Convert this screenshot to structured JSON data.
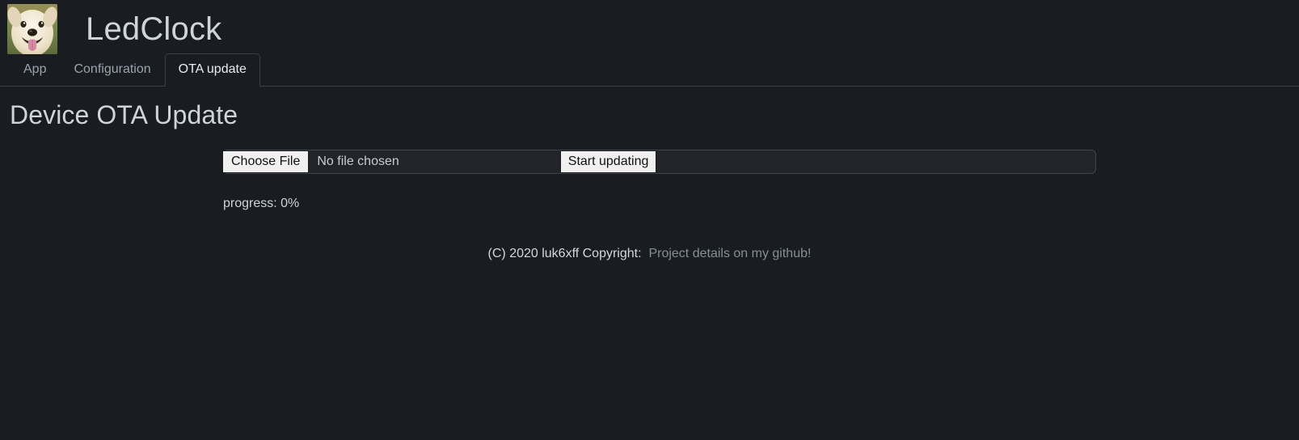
{
  "theme": {
    "background": "#191c21",
    "panel_background": "#212529",
    "border": "#3a4048",
    "text": "#ced4da",
    "muted_text": "#868e96",
    "button_background": "#f0f0f0",
    "button_text": "#101010"
  },
  "header": {
    "avatar_icon": "dog-photo-avatar",
    "title": "LedClock"
  },
  "tabs": {
    "items": [
      {
        "label": "App",
        "active": false
      },
      {
        "label": "Configuration",
        "active": false
      },
      {
        "label": "OTA update",
        "active": true
      }
    ]
  },
  "main": {
    "heading": "Device OTA Update",
    "upload": {
      "choose_file_label": "Choose File",
      "file_name": "No file chosen",
      "start_label": "Start updating"
    },
    "progress": {
      "text": "progress: 0%",
      "percent": 0
    }
  },
  "footer": {
    "copyright": "(C) 2020 luk6xff Copyright:",
    "link_label": "Project details on my github!"
  }
}
